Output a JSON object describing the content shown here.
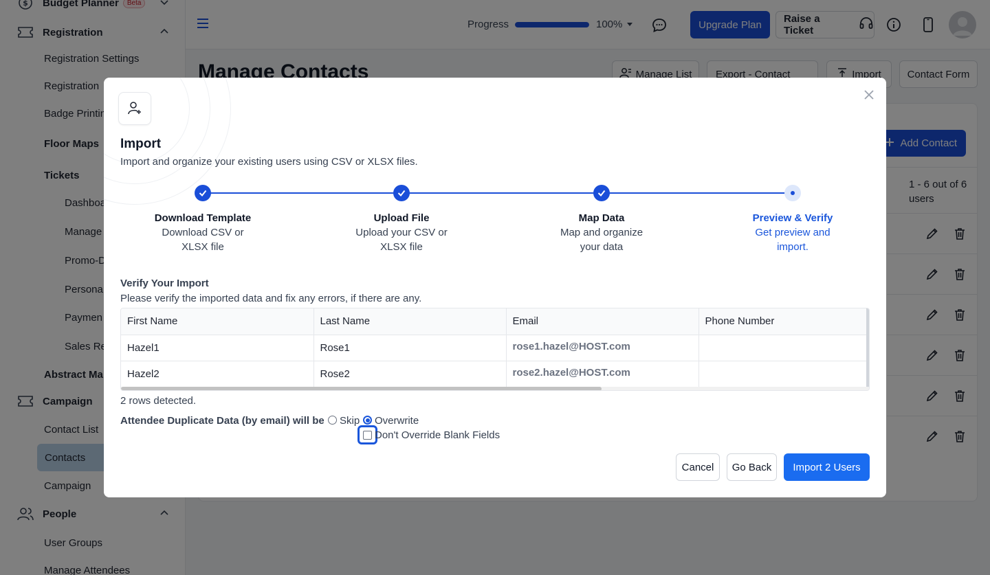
{
  "sidebar": {
    "budget_planner": "Budget Planner",
    "beta_badge": "Beta",
    "registration": "Registration",
    "registration_settings": "Registration Settings",
    "registration_form": "Registration",
    "badge_printing": "Badge Printin",
    "floor_maps": "Floor Maps",
    "tickets": "Tickets",
    "dashboard": "Dashboa",
    "manage": "Manage",
    "promo": "Promo-D",
    "personal": "Persona",
    "payment": "Paymen",
    "sales": "Sales Re",
    "abstract": "Abstract Ma",
    "campaign": "Campaign",
    "contact_list": "Contact List",
    "contacts": "Contacts",
    "campaign_sub": "Campaign",
    "people": "People",
    "user_groups": "User Groups",
    "manage_attendees": "Manage Attendees"
  },
  "topbar": {
    "progress_label": "Progress",
    "progress_value": "100%",
    "progress_fraction": 1.0,
    "upgrade_label": "Upgrade Plan",
    "ticket_label": "Raise a Ticket"
  },
  "page": {
    "title": "Manage Contacts",
    "manage_list": "Manage List",
    "export_contact": "Export - Contact",
    "import": "Import",
    "contact_form": "Contact Form",
    "add_contact": "Add Contact",
    "pager": "1 - 6 out of 6 users"
  },
  "modal": {
    "title": "Import",
    "subtitle": "Import and organize your existing users using CSV or XLSX files.",
    "steps": [
      {
        "title": "Download Template",
        "desc": "Download CSV or XLSX file",
        "state": "done"
      },
      {
        "title": "Upload File",
        "desc": "Upload your CSV or XLSX file",
        "state": "done"
      },
      {
        "title": "Map Data",
        "desc": "Map and organize your data",
        "state": "done"
      },
      {
        "title": "Preview & Verify",
        "desc": "Get preview and import.",
        "state": "current"
      }
    ],
    "verify_heading": "Verify Your Import",
    "verify_text": "Please verify the imported data and fix any errors, if there are any.",
    "table": {
      "headers": [
        "First Name",
        "Last Name",
        "Email",
        "Phone Number"
      ],
      "rows": [
        [
          "Hazel1",
          "Rose1",
          "rose1.hazel@HOST.com",
          ""
        ],
        [
          "Hazel2",
          "Rose2",
          "rose2.hazel@HOST.com",
          ""
        ]
      ]
    },
    "rows_detected": "2 rows detected.",
    "duplicate_label": "Attendee Duplicate Data (by email) will be",
    "option_skip": "Skip",
    "option_overwrite": "Overwrite",
    "selected_option": "Overwrite",
    "dont_override_label": "Don't Override Blank Fields",
    "dont_override_checked": false,
    "cancel": "Cancel",
    "go_back": "Go Back",
    "import_button": "Import 2 Users"
  },
  "colors": {
    "primary": "#1a4ed8",
    "primary_button": "#1a6cf0",
    "active_sidebar": "#b9d2e8",
    "current_step_text": "#1a56db"
  }
}
